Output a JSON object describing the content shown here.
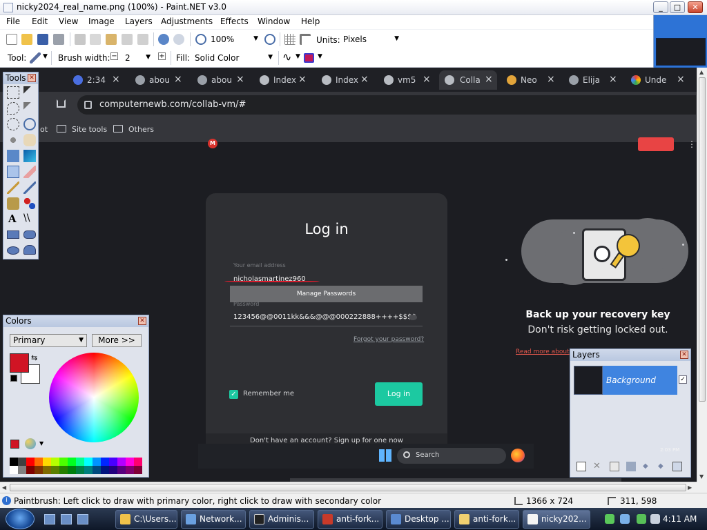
{
  "window": {
    "title": "nicky2024_real_name.png (100%) - Paint.NET v3.0",
    "minimize": "_",
    "maximize": "□",
    "close": "✕"
  },
  "menu": [
    "File",
    "Edit",
    "View",
    "Image",
    "Layers",
    "Adjustments",
    "Effects",
    "Window",
    "Help"
  ],
  "toolbar": {
    "zoom": "100%",
    "units_label": "Units:",
    "units_value": "Pixels",
    "tool_label": "Tool:",
    "brush_width_label": "Brush width:",
    "brush_width_value": "2",
    "fill_label": "Fill:",
    "fill_value": "Solid Color"
  },
  "canvas": {
    "tabs": [
      {
        "label": "2:34"
      },
      {
        "label": "abou"
      },
      {
        "label": "abou"
      },
      {
        "label": "Index"
      },
      {
        "label": "Index"
      },
      {
        "label": "vm5"
      },
      {
        "label": "Colla",
        "active": true
      },
      {
        "label": "Neo"
      },
      {
        "label": "Elija"
      },
      {
        "label": "Unde"
      }
    ],
    "url": "computernewb.com/collab-vm/#",
    "bookmarks": [
      "ot",
      "Site tools",
      "Others"
    ],
    "avatar_letter": "M",
    "login": {
      "title": "Log in",
      "email_label": "Your email address",
      "email_value": "nicholasmartinez960",
      "manage_passwords": "Manage Passwords",
      "password_label": "Password",
      "password_value": "123456@@0011kk&&&@@@000222888++++$$$$",
      "forgot": "Forgot your password?",
      "remember": "Remember me",
      "button": "Log in",
      "signup": "Don't have an account? Sign up for one now"
    },
    "promo": {
      "heading": "Back up your recovery key",
      "subheading": "Don't risk getting locked out.",
      "link": "Read more about"
    },
    "vm_taskbar": {
      "search_placeholder": "Search"
    }
  },
  "tools_panel": {
    "title": "Tools"
  },
  "colors_panel": {
    "title": "Colors",
    "selector": "Primary",
    "more_button": "More >>",
    "primary_color": "#d01424",
    "secondary_color": "#ffffff"
  },
  "layers_panel": {
    "title": "Layers",
    "layer_name": "Background",
    "clock_hint": "2:03 PM"
  },
  "statusbar": {
    "hint": "Paintbrush: Left click to draw with primary color, right click to draw with secondary color",
    "image_size": "1366 x 724",
    "cursor_pos": "311, 598"
  },
  "taskbar": {
    "buttons": [
      "C:\\Users...",
      "Network...",
      "Adminis...",
      "anti-fork...",
      "Desktop ...",
      "anti-fork...",
      "nicky202..."
    ],
    "clock": "4:11 AM"
  }
}
